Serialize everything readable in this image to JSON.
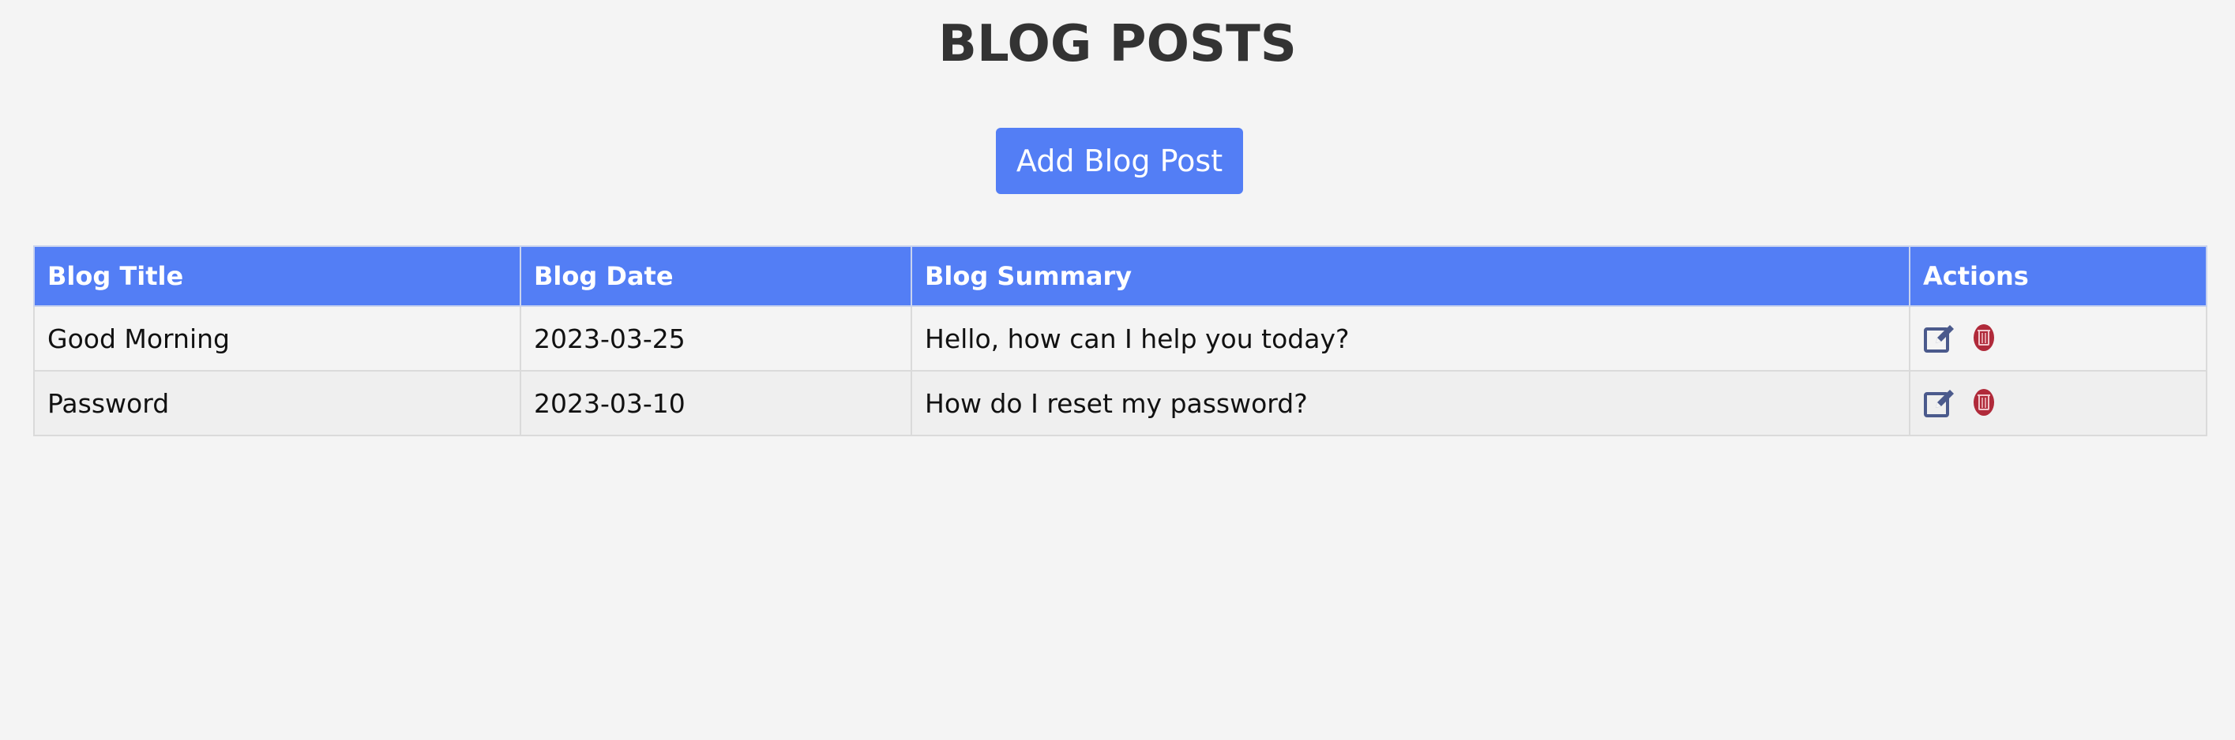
{
  "page": {
    "title": "BLOG POSTS",
    "add_button_label": "Add Blog Post"
  },
  "table": {
    "columns": [
      "Blog Title",
      "Blog Date",
      "Blog Summary",
      "Actions"
    ],
    "rows": [
      {
        "title": "Good Morning",
        "date": "2023-03-25",
        "summary": "Hello, how can I help you today?"
      },
      {
        "title": "Password",
        "date": "2023-03-10",
        "summary": "How do I reset my password?"
      }
    ]
  },
  "colors": {
    "accent": "#537ef5",
    "edit_icon": "#4b5a8c",
    "delete_icon": "#b02a3a",
    "background": "#f4f4f4"
  },
  "icons": {
    "edit": "edit-icon",
    "delete": "trash-icon"
  }
}
